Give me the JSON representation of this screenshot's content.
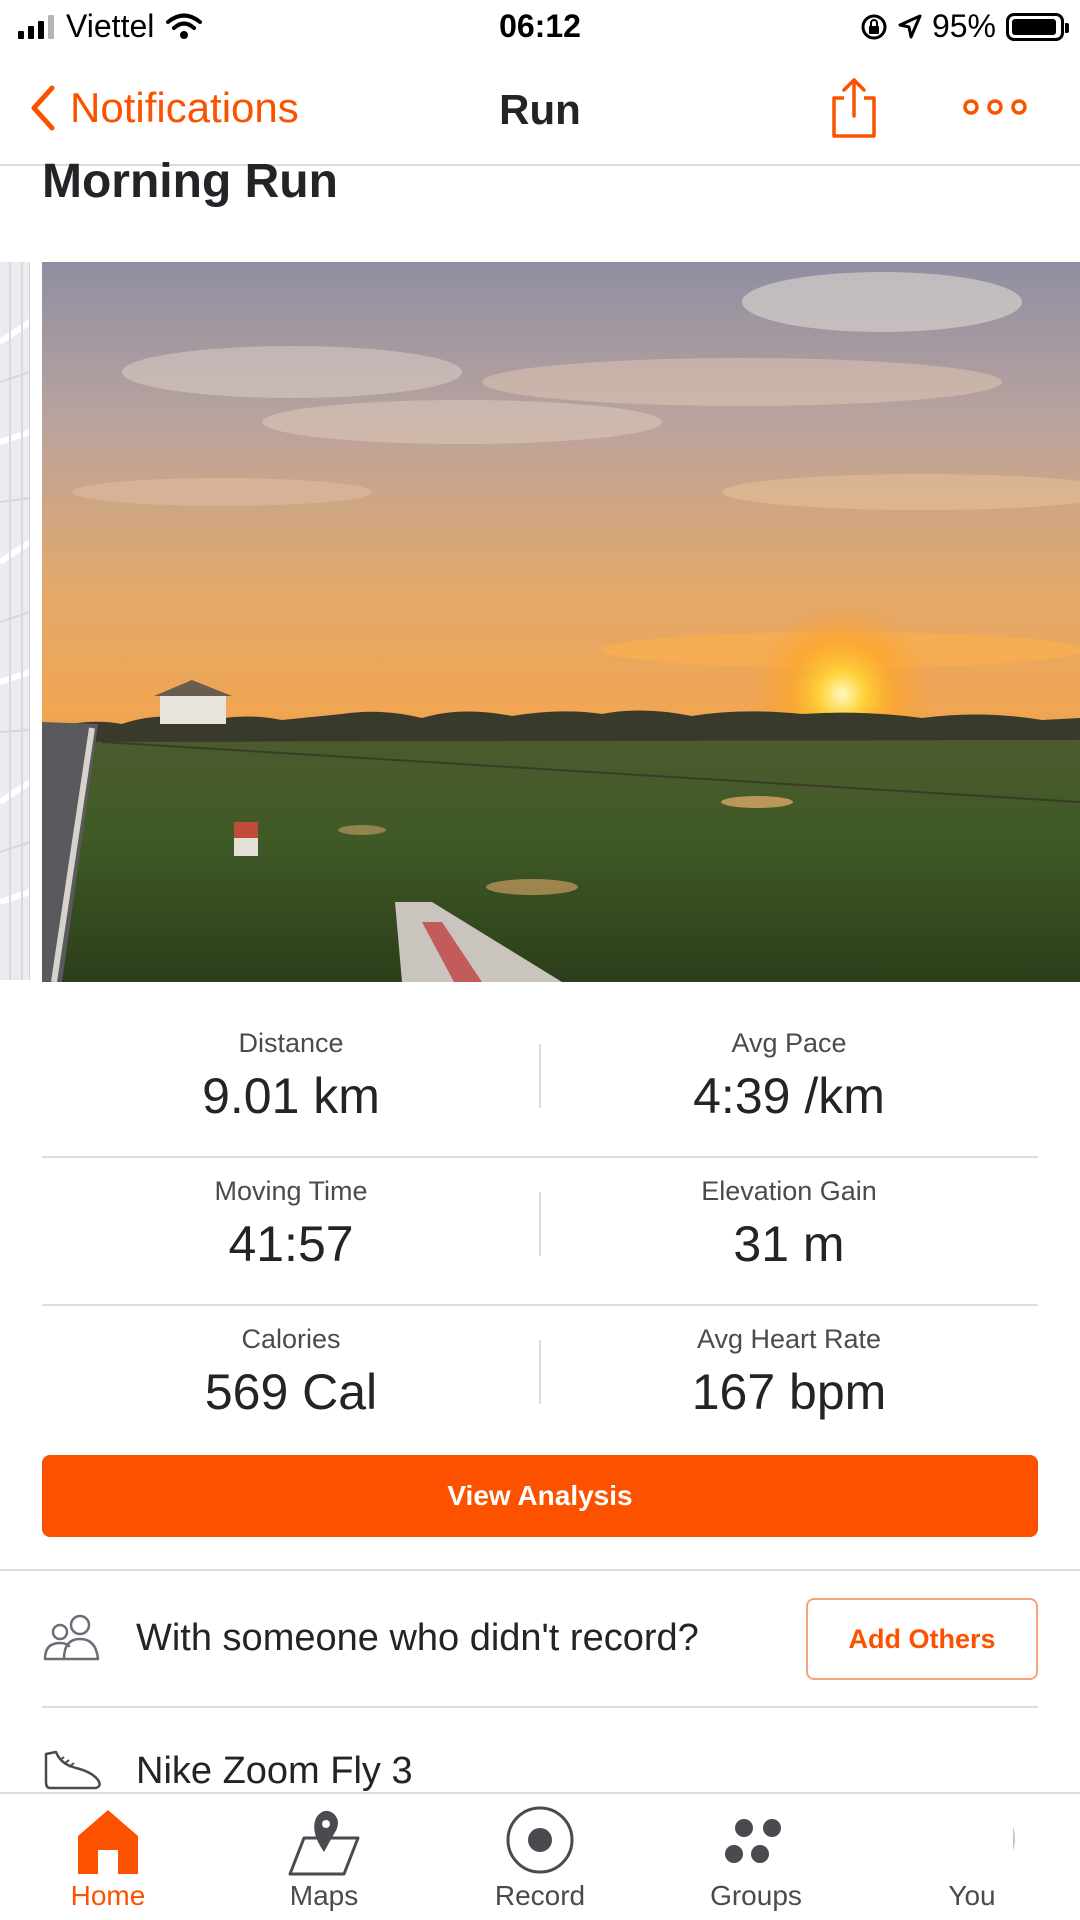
{
  "status_bar": {
    "carrier": "Viettel",
    "time": "06:12",
    "battery_text": "95%",
    "battery_level": 0.95
  },
  "nav": {
    "back_label": "Notifications",
    "title": "Run",
    "share_icon": "share-icon",
    "more_icon": "more-icon"
  },
  "activity": {
    "title": "Morning Run"
  },
  "stats": [
    {
      "left_label": "Distance",
      "left_value": "9.01 km",
      "right_label": "Avg Pace",
      "right_value": "4:39 /km"
    },
    {
      "left_label": "Moving Time",
      "left_value": "41:57",
      "right_label": "Elevation Gain",
      "right_value": "31 m"
    },
    {
      "left_label": "Calories",
      "left_value": "569 Cal",
      "right_label": "Avg Heart Rate",
      "right_value": "167 bpm"
    }
  ],
  "actions": {
    "view_analysis": "View Analysis",
    "with_others_text": "With someone who didn't record?",
    "add_others": "Add Others"
  },
  "gear": {
    "name": "Nike Zoom Fly 3"
  },
  "tabs": [
    {
      "label": "Home",
      "icon": "home-icon",
      "active": true
    },
    {
      "label": "Maps",
      "icon": "maps-icon",
      "active": false
    },
    {
      "label": "Record",
      "icon": "record-icon",
      "active": false
    },
    {
      "label": "Groups",
      "icon": "groups-icon",
      "active": false
    },
    {
      "label": "You",
      "icon": "avatar",
      "active": false
    }
  ],
  "colors": {
    "accent": "#fc5200",
    "text": "#242428",
    "divider": "#dcdcdc"
  }
}
